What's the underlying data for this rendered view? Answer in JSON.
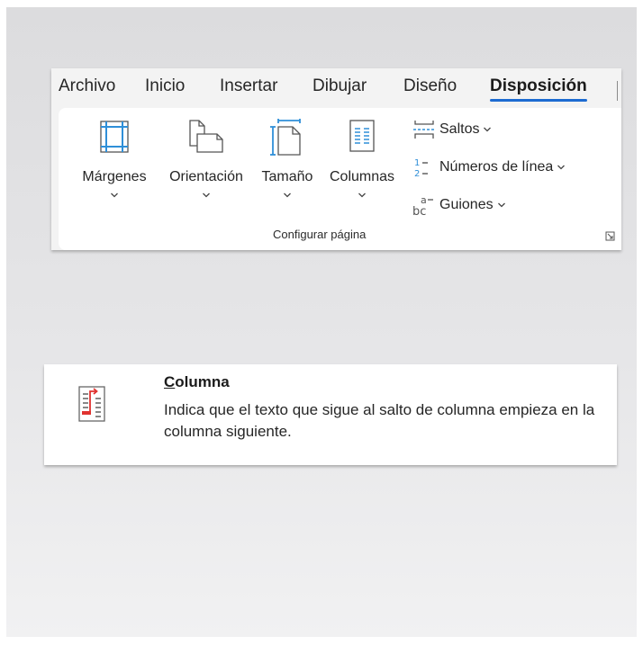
{
  "ribbon": {
    "tabs": [
      {
        "label": "Archivo"
      },
      {
        "label": "Inicio"
      },
      {
        "label": "Insertar"
      },
      {
        "label": "Dibujar"
      },
      {
        "label": "Diseño"
      },
      {
        "label": "Disposición",
        "active": true
      }
    ],
    "group": {
      "label": "Configurar página",
      "big_buttons": [
        {
          "label": "Márgenes",
          "icon": "margins-icon"
        },
        {
          "label": "Orientación",
          "icon": "orientation-icon"
        },
        {
          "label": "Tamaño",
          "icon": "size-icon"
        },
        {
          "label": "Columnas",
          "icon": "columns-icon"
        }
      ],
      "small_buttons": [
        {
          "label": "Saltos",
          "icon": "breaks-icon"
        },
        {
          "label": "Números de línea",
          "icon": "line-numbers-icon"
        },
        {
          "label": "Guiones",
          "icon": "hyphenation-icon"
        }
      ]
    },
    "accent_color": "#1d6bd1"
  },
  "tooltip": {
    "title_accel": "C",
    "title_rest": "olumna",
    "description": "Indica que el texto que sigue al salto de columna empieza en la columna siguiente.",
    "icon": "column-break-icon",
    "icon_accent": "#e0322f"
  }
}
